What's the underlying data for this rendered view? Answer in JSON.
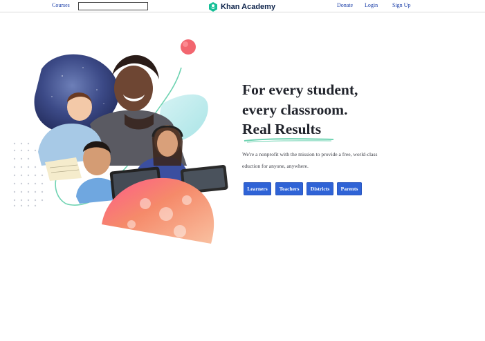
{
  "nav": {
    "courses_label": "Courses",
    "search_value": "",
    "logo_text": "Khan Academy",
    "donate_label": "Donate",
    "login_label": "Login",
    "signup_label": "Sign Up"
  },
  "hero": {
    "headline_line1": "For every student,",
    "headline_line2": "every classroom.",
    "headline_line3": "Real Results",
    "subtitle_line1": "We're a nonprofit with the mission to provide a free, world-class",
    "subtitle_line2": "eduction for anyone, anywhere.",
    "buttons": [
      "Learners",
      "Teachers",
      "Districts",
      "Parents"
    ]
  },
  "colors": {
    "link": "#1a3ea8",
    "logo_green": "#14bf96",
    "logo_navy": "#0b2149",
    "button_blue": "#2f63d6",
    "accent_teal": "#6fd3b2",
    "blob_coral": "#f07a6a",
    "blob_navy": "#3a4a86"
  },
  "icons": {
    "logo": "khan-academy-hexagon-icon"
  }
}
